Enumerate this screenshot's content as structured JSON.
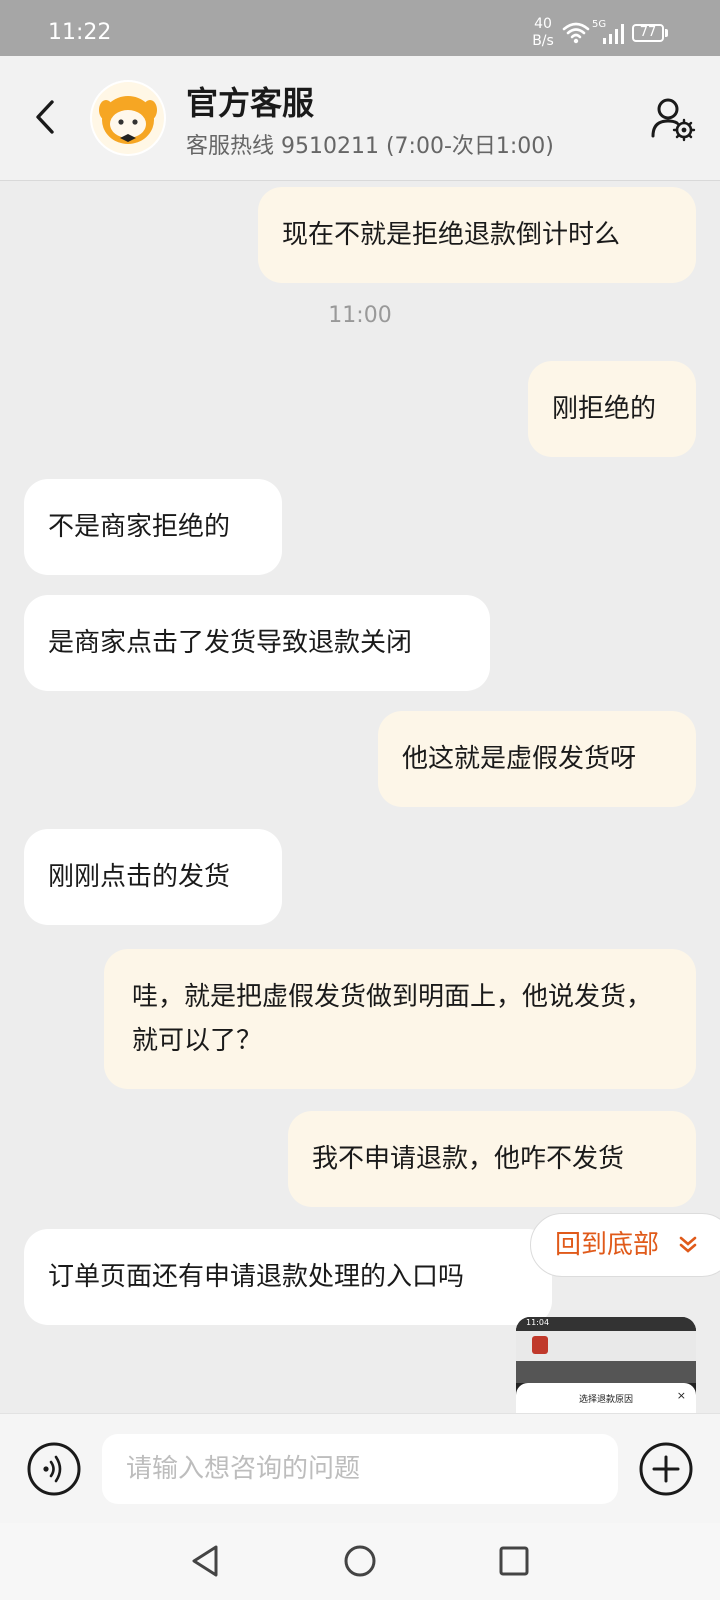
{
  "status_bar": {
    "time": "11:22",
    "net_speed_value": "40",
    "net_speed_unit": "B/s",
    "network_type": "5G",
    "battery": "77"
  },
  "header": {
    "title": "官方客服",
    "subtitle": "客服热线 9510211 (7:00-次日1:00)"
  },
  "messages": [
    {
      "text": "现在不就是拒绝退款倒计时么"
    },
    {
      "text": "刚拒绝的"
    },
    {
      "text": "不是商家拒绝的"
    },
    {
      "text": "是商家点击了发货导致退款关闭"
    },
    {
      "text": "他这就是虚假发货呀"
    },
    {
      "text": "刚刚点击的发货"
    },
    {
      "text": "哇，就是把虚假发货做到明面上，他说发货，就可以了？"
    },
    {
      "text": "我不申请退款，他咋不发货"
    },
    {
      "text": "订单页面还有申请退款处理的入口吗"
    }
  ],
  "timestamps": [
    "11:00"
  ],
  "scroll_to_bottom_label": "回到底部",
  "thumbnail": {
    "time": "11:04",
    "caption": "选择退款原因"
  },
  "input": {
    "placeholder": "请输入想咨询的问题"
  },
  "colors": {
    "accent": "#e05a1a",
    "outgoing_bubble": "#fdf6e8",
    "incoming_bubble": "#ffffff",
    "background": "#ededed"
  }
}
